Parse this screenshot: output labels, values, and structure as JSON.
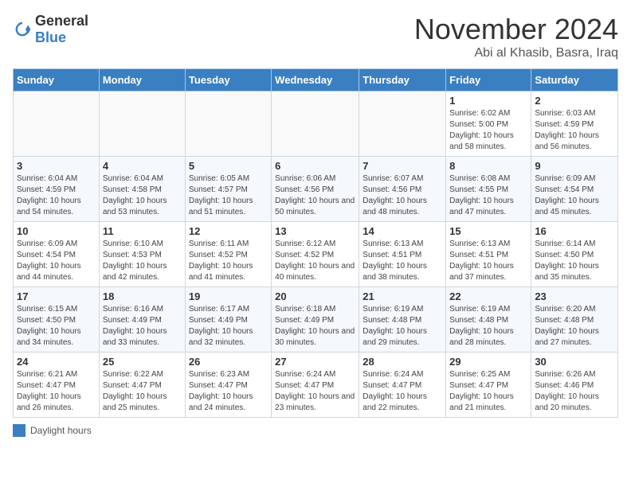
{
  "logo": {
    "text_general": "General",
    "text_blue": "Blue"
  },
  "header": {
    "month": "November 2024",
    "location": "Abi al Khasib, Basra, Iraq"
  },
  "days": [
    "Sunday",
    "Monday",
    "Tuesday",
    "Wednesday",
    "Thursday",
    "Friday",
    "Saturday"
  ],
  "legend": {
    "label": "Daylight hours"
  },
  "weeks": [
    [
      {
        "day": "",
        "info": ""
      },
      {
        "day": "",
        "info": ""
      },
      {
        "day": "",
        "info": ""
      },
      {
        "day": "",
        "info": ""
      },
      {
        "day": "",
        "info": ""
      },
      {
        "day": "1",
        "info": "Sunrise: 6:02 AM\nSunset: 5:00 PM\nDaylight: 10 hours and 58 minutes."
      },
      {
        "day": "2",
        "info": "Sunrise: 6:03 AM\nSunset: 4:59 PM\nDaylight: 10 hours and 56 minutes."
      }
    ],
    [
      {
        "day": "3",
        "info": "Sunrise: 6:04 AM\nSunset: 4:59 PM\nDaylight: 10 hours and 54 minutes."
      },
      {
        "day": "4",
        "info": "Sunrise: 6:04 AM\nSunset: 4:58 PM\nDaylight: 10 hours and 53 minutes."
      },
      {
        "day": "5",
        "info": "Sunrise: 6:05 AM\nSunset: 4:57 PM\nDaylight: 10 hours and 51 minutes."
      },
      {
        "day": "6",
        "info": "Sunrise: 6:06 AM\nSunset: 4:56 PM\nDaylight: 10 hours and 50 minutes."
      },
      {
        "day": "7",
        "info": "Sunrise: 6:07 AM\nSunset: 4:56 PM\nDaylight: 10 hours and 48 minutes."
      },
      {
        "day": "8",
        "info": "Sunrise: 6:08 AM\nSunset: 4:55 PM\nDaylight: 10 hours and 47 minutes."
      },
      {
        "day": "9",
        "info": "Sunrise: 6:09 AM\nSunset: 4:54 PM\nDaylight: 10 hours and 45 minutes."
      }
    ],
    [
      {
        "day": "10",
        "info": "Sunrise: 6:09 AM\nSunset: 4:54 PM\nDaylight: 10 hours and 44 minutes."
      },
      {
        "day": "11",
        "info": "Sunrise: 6:10 AM\nSunset: 4:53 PM\nDaylight: 10 hours and 42 minutes."
      },
      {
        "day": "12",
        "info": "Sunrise: 6:11 AM\nSunset: 4:52 PM\nDaylight: 10 hours and 41 minutes."
      },
      {
        "day": "13",
        "info": "Sunrise: 6:12 AM\nSunset: 4:52 PM\nDaylight: 10 hours and 40 minutes."
      },
      {
        "day": "14",
        "info": "Sunrise: 6:13 AM\nSunset: 4:51 PM\nDaylight: 10 hours and 38 minutes."
      },
      {
        "day": "15",
        "info": "Sunrise: 6:13 AM\nSunset: 4:51 PM\nDaylight: 10 hours and 37 minutes."
      },
      {
        "day": "16",
        "info": "Sunrise: 6:14 AM\nSunset: 4:50 PM\nDaylight: 10 hours and 35 minutes."
      }
    ],
    [
      {
        "day": "17",
        "info": "Sunrise: 6:15 AM\nSunset: 4:50 PM\nDaylight: 10 hours and 34 minutes."
      },
      {
        "day": "18",
        "info": "Sunrise: 6:16 AM\nSunset: 4:49 PM\nDaylight: 10 hours and 33 minutes."
      },
      {
        "day": "19",
        "info": "Sunrise: 6:17 AM\nSunset: 4:49 PM\nDaylight: 10 hours and 32 minutes."
      },
      {
        "day": "20",
        "info": "Sunrise: 6:18 AM\nSunset: 4:49 PM\nDaylight: 10 hours and 30 minutes."
      },
      {
        "day": "21",
        "info": "Sunrise: 6:19 AM\nSunset: 4:48 PM\nDaylight: 10 hours and 29 minutes."
      },
      {
        "day": "22",
        "info": "Sunrise: 6:19 AM\nSunset: 4:48 PM\nDaylight: 10 hours and 28 minutes."
      },
      {
        "day": "23",
        "info": "Sunrise: 6:20 AM\nSunset: 4:48 PM\nDaylight: 10 hours and 27 minutes."
      }
    ],
    [
      {
        "day": "24",
        "info": "Sunrise: 6:21 AM\nSunset: 4:47 PM\nDaylight: 10 hours and 26 minutes."
      },
      {
        "day": "25",
        "info": "Sunrise: 6:22 AM\nSunset: 4:47 PM\nDaylight: 10 hours and 25 minutes."
      },
      {
        "day": "26",
        "info": "Sunrise: 6:23 AM\nSunset: 4:47 PM\nDaylight: 10 hours and 24 minutes."
      },
      {
        "day": "27",
        "info": "Sunrise: 6:24 AM\nSunset: 4:47 PM\nDaylight: 10 hours and 23 minutes."
      },
      {
        "day": "28",
        "info": "Sunrise: 6:24 AM\nSunset: 4:47 PM\nDaylight: 10 hours and 22 minutes."
      },
      {
        "day": "29",
        "info": "Sunrise: 6:25 AM\nSunset: 4:47 PM\nDaylight: 10 hours and 21 minutes."
      },
      {
        "day": "30",
        "info": "Sunrise: 6:26 AM\nSunset: 4:46 PM\nDaylight: 10 hours and 20 minutes."
      }
    ]
  ]
}
